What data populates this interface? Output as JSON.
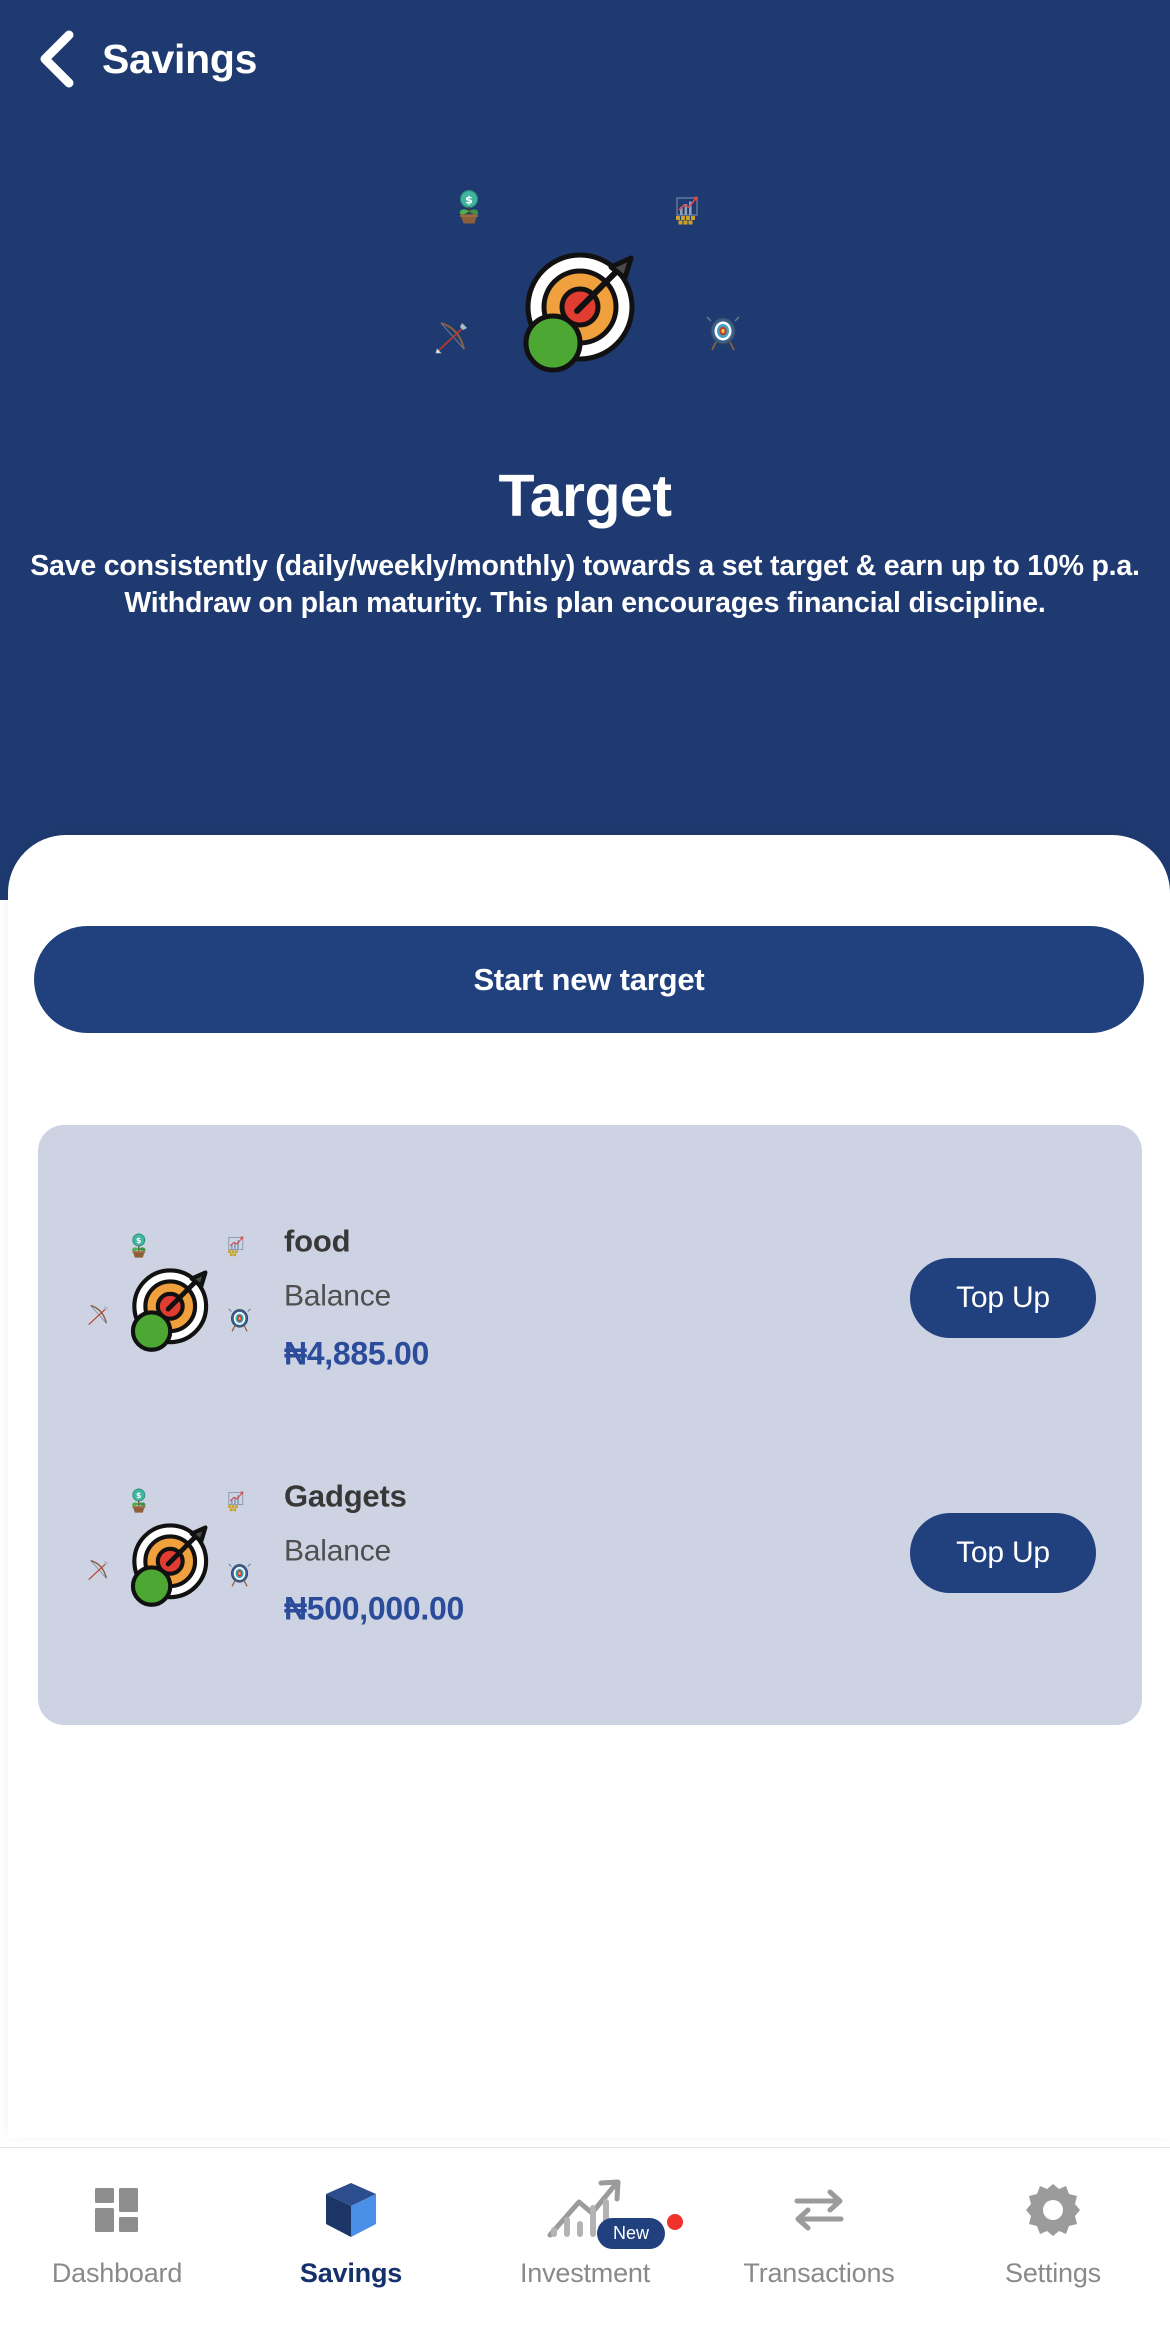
{
  "header": {
    "back_icon": "chevron-left-icon",
    "title": "Savings"
  },
  "hero": {
    "illustration": "target-dartboard-illustration",
    "satellite_icons": [
      "money-plant-icon",
      "bar-chart-growth-icon",
      "bow-and-arrow-icon",
      "archery-target-icon"
    ],
    "title": "Target",
    "description": "Save consistently (daily/weekly/monthly) towards a set target & earn up to 10% p.a. Withdraw on plan maturity.\nThis plan encourages financial discipline."
  },
  "sheet": {
    "start_button_label": "Start new target"
  },
  "plans": [
    {
      "name": "food",
      "balance_label": "Balance",
      "balance_value": "₦4,885.00",
      "action_label": "Top Up",
      "icon": "target-dartboard-icon"
    },
    {
      "name": "Gadgets",
      "balance_label": "Balance",
      "balance_value": "₦500,000.00",
      "action_label": "Top Up",
      "icon": "target-dartboard-icon"
    }
  ],
  "bottom_nav": {
    "items": [
      {
        "label": "Dashboard",
        "icon": "grid-dashboard-icon",
        "active": false
      },
      {
        "label": "Savings",
        "icon": "cube-savings-icon",
        "active": true
      },
      {
        "label": "Investment",
        "icon": "growth-chart-icon",
        "active": false,
        "badge": "New"
      },
      {
        "label": "Transactions",
        "icon": "swap-arrows-icon",
        "active": false
      },
      {
        "label": "Settings",
        "icon": "gear-icon",
        "active": false
      }
    ]
  },
  "colors": {
    "navy": "#1E3A70",
    "button_navy": "#21407E",
    "card_bg": "#CDD3E2",
    "balance_blue": "#2B4C9B",
    "nav_inactive": "#8A8A8A",
    "nav_active": "#15306B",
    "badge_red": "#F0322B"
  }
}
